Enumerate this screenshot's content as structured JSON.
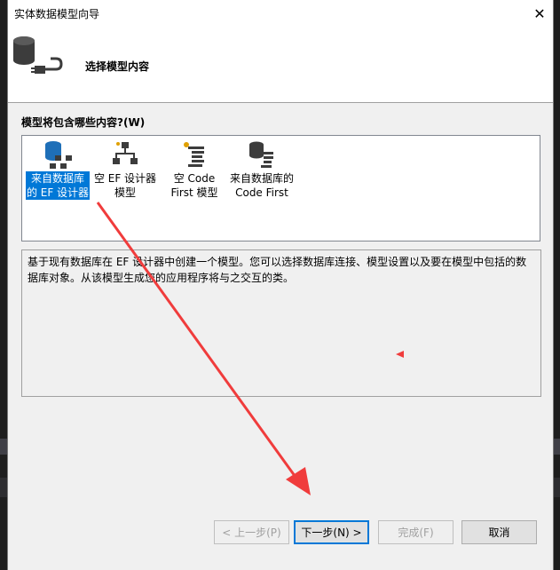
{
  "dialog": {
    "title": "实体数据模型向导",
    "close_glyph": "✕",
    "header_title": "选择模型内容",
    "prompt": "模型将包含哪些内容?",
    "prompt_mnemonic": "(W)"
  },
  "model_options": [
    {
      "line1": "来自数据库",
      "line2": "的 EF 设计器",
      "icon": "database-model-icon",
      "selected": true
    },
    {
      "line1": "空 EF 设计器",
      "line2": "模型",
      "icon": "empty-designer-icon",
      "selected": false
    },
    {
      "line1": "空 Code",
      "line2": "First 模型",
      "icon": "empty-code-first-icon",
      "selected": false
    },
    {
      "line1": "来自数据库的",
      "line2": "Code First",
      "icon": "database-code-first-icon",
      "selected": false
    }
  ],
  "description": "基于现有数据库在 EF 设计器中创建一个模型。您可以选择数据库连接、模型设置以及要在模型中包括的数据库对象。从该模型生成您的应用程序将与之交互的类。",
  "buttons": {
    "back": "< 上一步(P)",
    "next": "下一步(N) >",
    "finish": "完成(F)",
    "cancel": "取消"
  },
  "colors": {
    "selection": "#0078d7",
    "annotation_arrow": "#f03c3c"
  }
}
